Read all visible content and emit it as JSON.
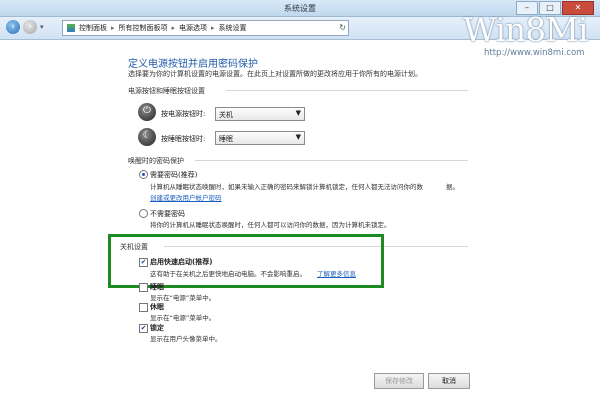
{
  "window": {
    "title": "系统设置",
    "controls": [
      "–",
      "□",
      "✕"
    ]
  },
  "address": {
    "recent": "▾",
    "crumbs": [
      "控制面板",
      "所有控制面板项",
      "电源选项",
      "系统设置"
    ],
    "refresh": "↻"
  },
  "watermark": {
    "logo": "Win8Mi",
    "url": "http://www.win8mi.com"
  },
  "page": {
    "title": "定义电源按钮并启用密码保护",
    "subtitle": "选择要为你的计算机设置的电源设置。在此页上对设置所做的更改将应用于你所有的电源计划。"
  },
  "buttons_section": {
    "heading": "电源按钮和睡眠按钮设置",
    "power_label": "按电源按钮时:",
    "power_value": "关机",
    "sleep_label": "按睡眠按钮时:",
    "sleep_value": "睡眠"
  },
  "wake_section": {
    "heading": "唤醒时的密码保护",
    "opt1_title": "需要密码(推荐)",
    "opt1_desc": "计算机从睡眠状态唤醒时，如果未输入正确的密码来解锁计算机锁定，任何人都无法访问你的数",
    "opt1_desc2": "据。",
    "opt1_link": "创建或更改用户帐户密码",
    "opt2_title": "不需要密码",
    "opt2_desc": "将你的计算机从睡眠状态唤醒时，任何人都可以访问你的数据，因为计算机未锁定。"
  },
  "shutdown_section": {
    "heading": "关机设置",
    "fast_title": "启用快速启动(推荐)",
    "fast_desc": "这有助于在关机之后更快地启动电脑。不会影响重启。",
    "fast_link": "了解更多信息",
    "hibernate_title": "睡眠",
    "hibernate_desc": "显示在“电源”菜单中。",
    "sleep_title": "休眠",
    "sleep_desc": "显示在“电源”菜单中。",
    "lock_title": "锁定",
    "lock_desc": "显示在用户头像菜单中。"
  },
  "footer": {
    "save": "保存修改",
    "cancel": "取消"
  }
}
